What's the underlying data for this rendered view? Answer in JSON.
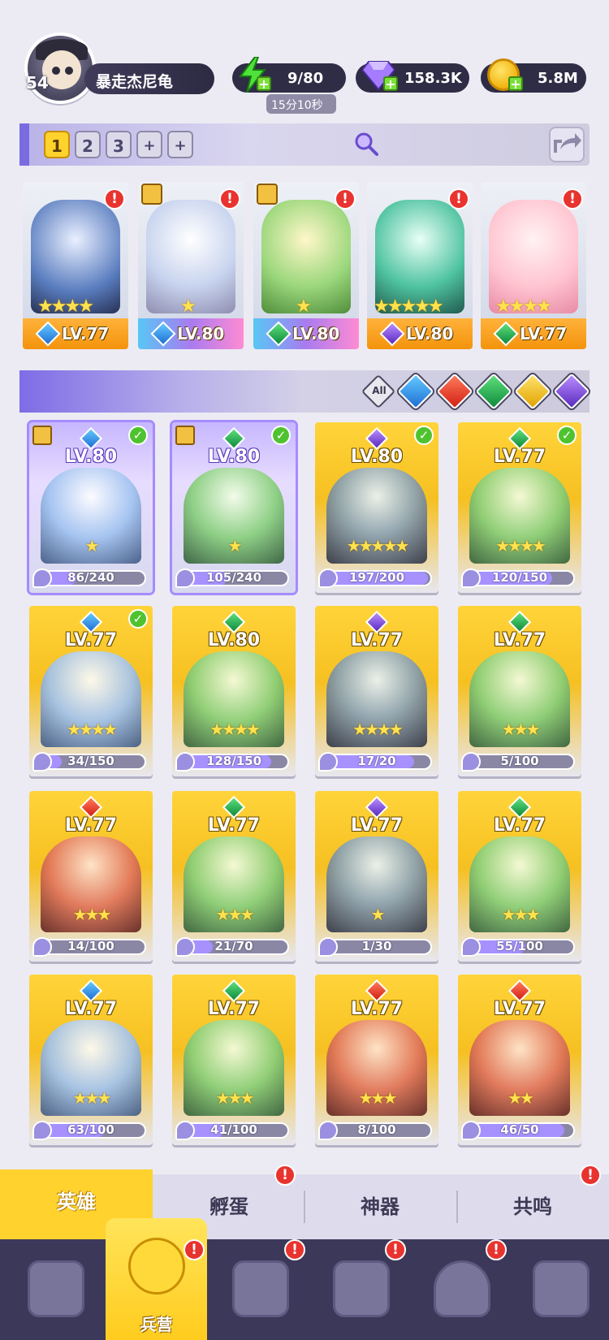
{
  "player": {
    "level": "54",
    "name": "暴走杰尼龟"
  },
  "resources": {
    "energy": {
      "value": "9/80",
      "timer": "15分10秒"
    },
    "gems": {
      "value": "158.3K"
    },
    "gold": {
      "value": "5.8M"
    }
  },
  "team_tabs": [
    "1",
    "2",
    "3",
    "+",
    "+"
  ],
  "team_slots": [
    {
      "level": "LV.77",
      "stars": "★★★★",
      "element": "water",
      "alert": "!"
    },
    {
      "level": "LV.80",
      "stars": "★",
      "element": "water",
      "alert": "!"
    },
    {
      "level": "LV.80",
      "stars": "★",
      "element": "wind",
      "alert": "!"
    },
    {
      "level": "LV.80",
      "stars": "★★★★★",
      "element": "dark",
      "alert": "!"
    },
    {
      "level": "LV.77",
      "stars": "★★★★",
      "element": "wind",
      "alert": "!"
    }
  ],
  "filter": {
    "all_label": "All",
    "elements": [
      "water",
      "fire",
      "wind",
      "light",
      "dark"
    ]
  },
  "heroes": [
    {
      "level": "LV.80",
      "element": "water",
      "fragments": "86/240",
      "progress": 0.36,
      "stars": "★",
      "epic": true,
      "check": true
    },
    {
      "level": "LV.80",
      "element": "wind",
      "fragments": "105/240",
      "progress": 0.44,
      "stars": "★",
      "epic": true,
      "check": true
    },
    {
      "level": "LV.80",
      "element": "dark",
      "fragments": "197/200",
      "progress": 0.98,
      "stars": "★★★★★",
      "epic": false,
      "check": true
    },
    {
      "level": "LV.77",
      "element": "wind",
      "fragments": "120/150",
      "progress": 0.8,
      "stars": "★★★★",
      "epic": false,
      "check": true
    },
    {
      "level": "LV.77",
      "element": "water",
      "fragments": "34/150",
      "progress": 0.23,
      "stars": "★★★★",
      "epic": false,
      "check": true
    },
    {
      "level": "LV.80",
      "element": "wind",
      "fragments": "128/150",
      "progress": 0.85,
      "stars": "★★★★",
      "epic": false,
      "check": false
    },
    {
      "level": "LV.77",
      "element": "dark",
      "fragments": "17/20",
      "progress": 0.85,
      "stars": "★★★★",
      "epic": false,
      "check": false
    },
    {
      "level": "LV.77",
      "element": "wind",
      "fragments": "5/100",
      "progress": 0.05,
      "stars": "★★★",
      "epic": false,
      "check": false
    },
    {
      "level": "LV.77",
      "element": "fire",
      "fragments": "14/100",
      "progress": 0.14,
      "stars": "★★★",
      "epic": false,
      "check": false
    },
    {
      "level": "LV.77",
      "element": "wind",
      "fragments": "21/70",
      "progress": 0.3,
      "stars": "★★★",
      "epic": false,
      "check": false
    },
    {
      "level": "LV.77",
      "element": "dark",
      "fragments": "1/30",
      "progress": 0.03,
      "stars": "★",
      "epic": false,
      "check": false
    },
    {
      "level": "LV.77",
      "element": "wind",
      "fragments": "55/100",
      "progress": 0.55,
      "stars": "★★★",
      "epic": false,
      "check": false
    },
    {
      "level": "LV.77",
      "element": "water",
      "fragments": "63/100",
      "progress": 0.63,
      "stars": "★★★",
      "epic": false,
      "check": false
    },
    {
      "level": "LV.77",
      "element": "wind",
      "fragments": "41/100",
      "progress": 0.41,
      "stars": "★★★",
      "epic": false,
      "check": false
    },
    {
      "level": "LV.77",
      "element": "fire",
      "fragments": "8/100",
      "progress": 0.08,
      "stars": "★★★",
      "epic": false,
      "check": false
    },
    {
      "level": "LV.77",
      "element": "fire",
      "fragments": "46/50",
      "progress": 0.92,
      "stars": "★★",
      "epic": false,
      "check": false
    }
  ],
  "sub_tabs": [
    "英雄",
    "孵蛋",
    "神器",
    "共鸣"
  ],
  "nav": {
    "active_label": "兵营"
  },
  "alert_mark": "!",
  "check_mark": "✓",
  "colors": {
    "accent": "#ffd22e",
    "nav_bg": "#3c385a",
    "alert": "#e8332f"
  }
}
